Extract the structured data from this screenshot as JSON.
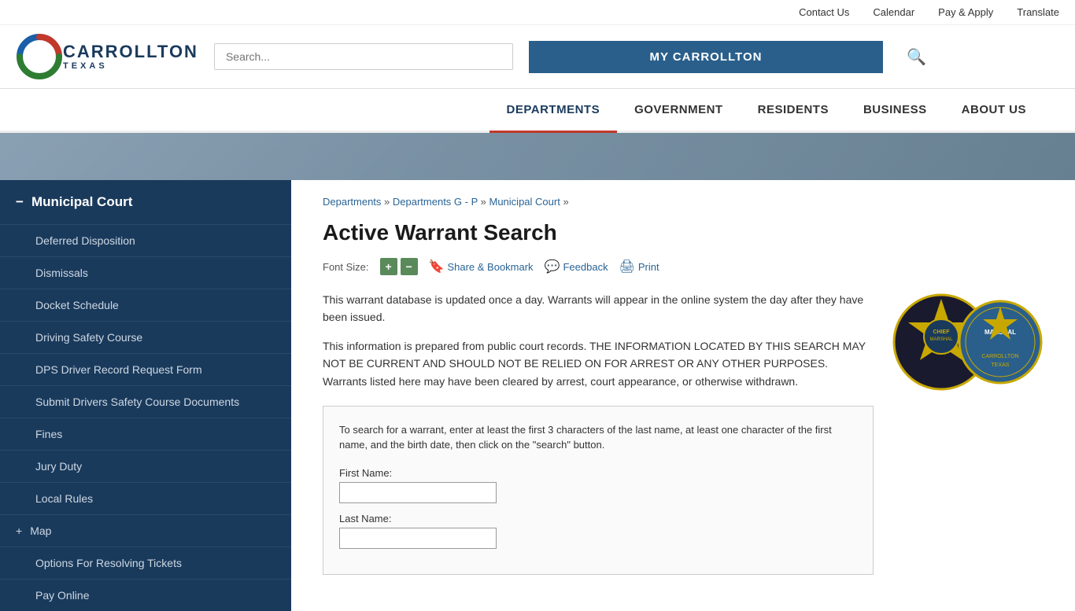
{
  "utility": {
    "contact_us": "Contact Us",
    "calendar": "Calendar",
    "pay_apply": "Pay & Apply",
    "translate": "Translate"
  },
  "header": {
    "logo_name": "CARROLLTON",
    "logo_sub": "TEXAS",
    "search_placeholder": "Search...",
    "my_carrollton": "MY CARROLLTON",
    "search_icon": "🔍"
  },
  "nav": {
    "items": [
      {
        "label": "DEPARTMENTS",
        "active": true
      },
      {
        "label": "GOVERNMENT",
        "active": false
      },
      {
        "label": "RESIDENTS",
        "active": false
      },
      {
        "label": "BUSINESS",
        "active": false
      },
      {
        "label": "ABOUT US",
        "active": false
      }
    ]
  },
  "sidebar": {
    "title": "Municipal Court",
    "toggle": "−",
    "items": [
      {
        "label": "Deferred Disposition"
      },
      {
        "label": "Dismissals"
      },
      {
        "label": "Docket Schedule"
      },
      {
        "label": "Driving Safety Course"
      },
      {
        "label": "DPS Driver Record Request Form"
      },
      {
        "label": "Submit Drivers Safety Course Documents"
      },
      {
        "label": "Fines"
      },
      {
        "label": "Jury Duty"
      },
      {
        "label": "Local Rules"
      },
      {
        "label": "Map",
        "toggle": "+"
      },
      {
        "label": "Options For Resolving Tickets"
      },
      {
        "label": "Pay Online"
      }
    ]
  },
  "breadcrumb": {
    "departments": "Departments",
    "departments_g_p": "Departments G - P",
    "municipal_court": "Municipal Court",
    "sep": "»"
  },
  "content": {
    "page_title": "Active Warrant Search",
    "font_size_label": "Font Size:",
    "font_plus": "+",
    "font_minus": "−",
    "share_bookmark": "Share & Bookmark",
    "feedback": "Feedback",
    "print": "Print",
    "body1": "This warrant database is updated once a day. Warrants will appear in the online system the day after they have been issued.",
    "body2": "This information is prepared from public court records. THE INFORMATION LOCATED BY THIS SEARCH MAY NOT BE CURRENT AND SHOULD NOT BE RELIED ON FOR ARREST OR ANY OTHER PURPOSES. Warrants listed here may have been cleared by arrest, court appearance, or otherwise withdrawn.",
    "search_instruction": "To search for a warrant, enter at least the first 3 characters of the last name, at least one character of the first name, and the birth date, then click on the \"search\" button.",
    "first_name_label": "First Name:",
    "last_name_label": "Last Name:"
  }
}
